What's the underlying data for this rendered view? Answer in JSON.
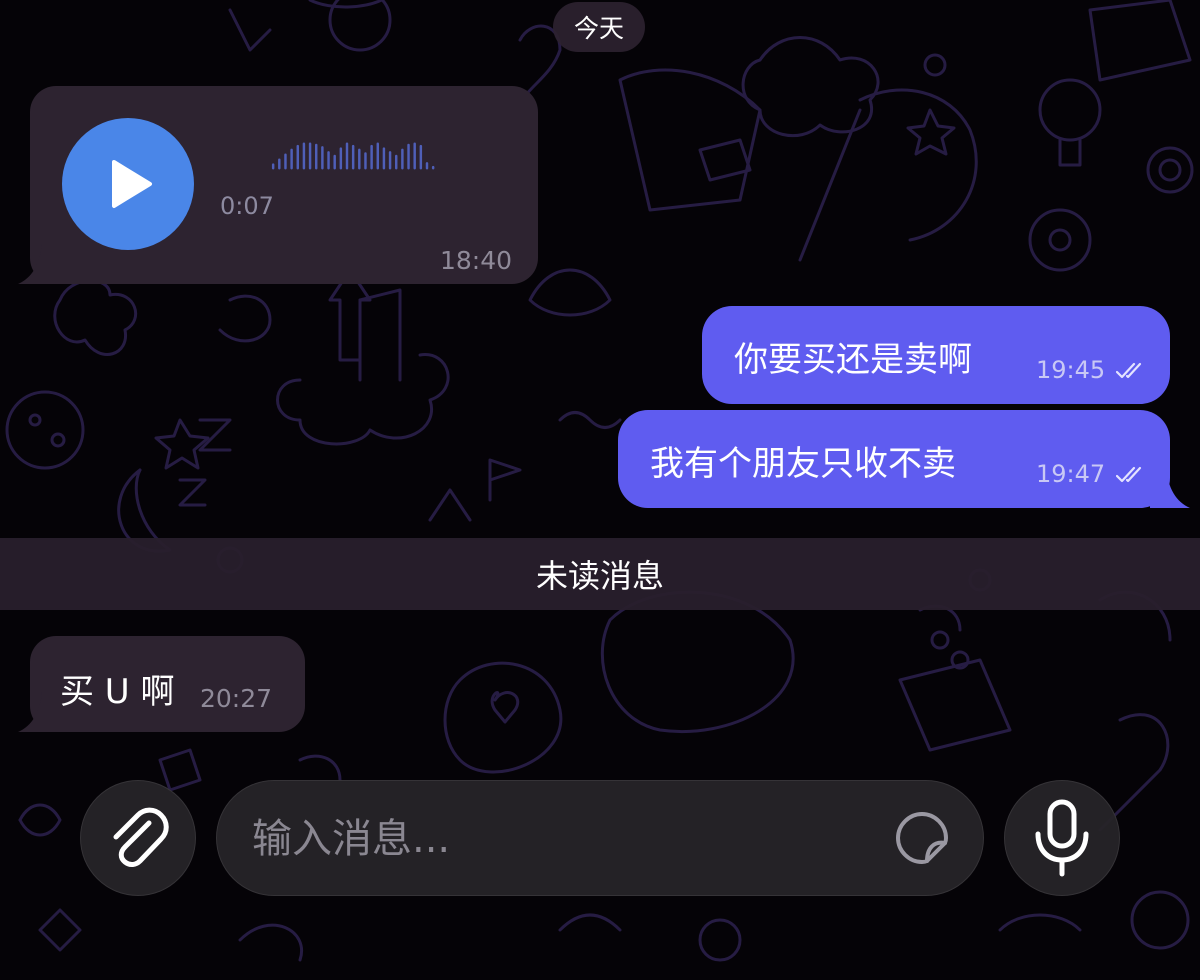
{
  "chat": {
    "date_label": "今天",
    "messages": [
      {
        "direction": "incoming",
        "type": "voice",
        "duration": "0:07",
        "time": "18:40",
        "icon": "play-icon"
      },
      {
        "direction": "outgoing",
        "type": "text",
        "text": "你要买还是卖啊",
        "time": "19:45",
        "status_icon": "double-check-icon"
      },
      {
        "direction": "outgoing",
        "type": "text",
        "text": "我有个朋友只收不卖",
        "time": "19:47",
        "status_icon": "double-check-icon"
      },
      {
        "direction": "incoming",
        "type": "text",
        "text": "买 U 啊",
        "time": "20:27"
      }
    ],
    "unread_divider": "未读消息"
  },
  "composer": {
    "placeholder": "输入消息...",
    "attach_icon": "paperclip-icon",
    "sticker_icon": "sticker-icon",
    "mic_icon": "microphone-icon"
  },
  "colors": {
    "background": "#050307",
    "incoming_bubble": "#2d2330",
    "outgoing_bubble": "#5f5cf0",
    "play_button": "#4a86e8",
    "waveform": "#4f5fb8"
  }
}
